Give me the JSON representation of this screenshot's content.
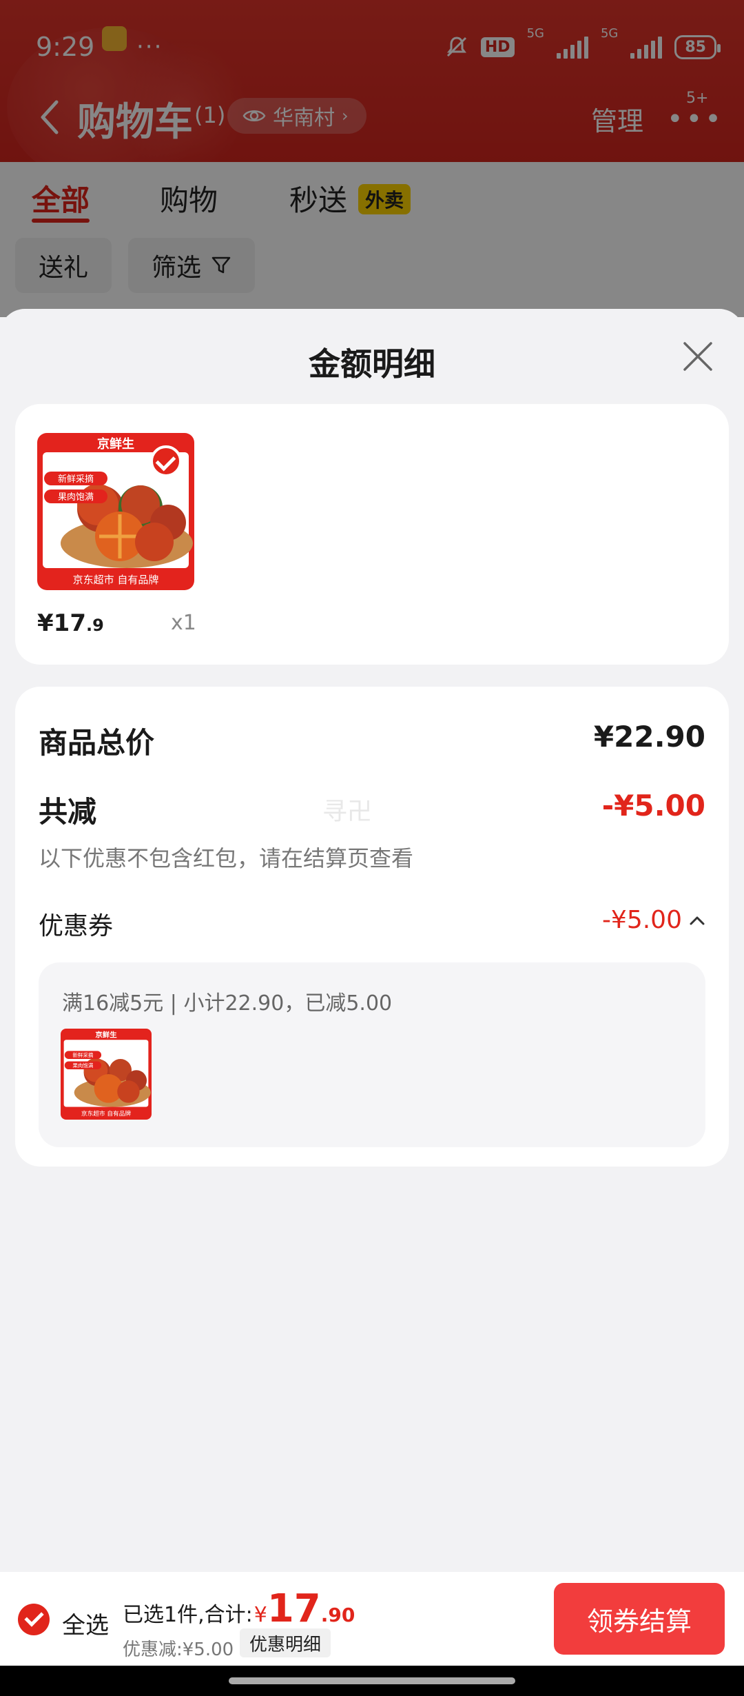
{
  "status_bar": {
    "time": "9:29",
    "more": "···",
    "hd": "HD",
    "net1": "5G",
    "net2": "5G",
    "battery": "85"
  },
  "nav": {
    "title": "购物车",
    "count": "(1)",
    "location": "华南村",
    "manage": "管理",
    "more": "•••",
    "badge": "5+"
  },
  "tabs": [
    {
      "label": "全部"
    },
    {
      "label": "购物"
    },
    {
      "label": "秒送"
    }
  ],
  "takeout_tag": "外卖",
  "chips": {
    "gift": "送礼",
    "filter": "筛选"
  },
  "sheet": {
    "title": "金额明细"
  },
  "product": {
    "brand": "京鲜生",
    "tags": [
      "新鲜采摘",
      "果肉饱满"
    ],
    "footer": "京东超市 自有品牌",
    "price_int": "¥17",
    "price_dec": ".9",
    "qty": "x1",
    "selected": true
  },
  "summary": {
    "total_label": "商品总价",
    "total_value": "¥22.90",
    "reduce_label": "共减",
    "reduce_value": "-¥5.00",
    "reduce_note": "以下优惠不包含红包，请在结算页查看",
    "watermark": "寻卍",
    "coupon_label": "优惠券",
    "coupon_value": "-¥5.00",
    "coupon_desc": "满16减5元 | 小计22.90，已减5.00"
  },
  "bottom": {
    "select_all": "全选",
    "selected_text": "已选1件,合计:",
    "currency": "¥",
    "amount_int": "17",
    "amount_dec": ".90",
    "discount_text": "优惠减:¥5.00",
    "detail_label": "优惠明细",
    "checkout_label": "领券结算"
  },
  "colors": {
    "accent": "#e1251b",
    "checkout": "#f23d3d",
    "header_red": "#d2261e"
  }
}
